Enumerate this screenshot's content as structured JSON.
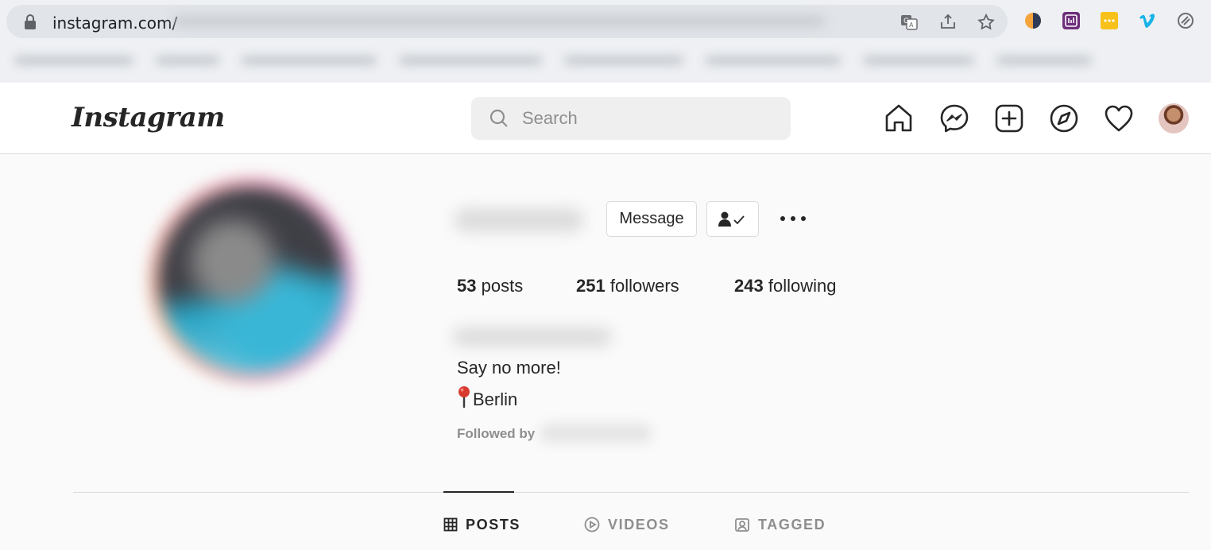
{
  "browser": {
    "url": "instagram.com/",
    "icons": [
      "lock-icon",
      "translate-icon",
      "share-icon",
      "bookmark-star-icon"
    ],
    "extensions": [
      "extension-color-wheel-icon",
      "extension-purple-app-icon",
      "extension-yellow-dots-icon",
      "extension-vimeo-icon",
      "extension-circle-slash-icon"
    ]
  },
  "header": {
    "logo": "Instagram",
    "search_placeholder": "Search",
    "nav_icons": [
      "home-icon",
      "messenger-icon",
      "new-post-icon",
      "explore-icon",
      "activity-heart-icon",
      "profile-avatar"
    ]
  },
  "profile": {
    "message_button": "Message",
    "stats": {
      "posts_count": "53",
      "posts_label": "posts",
      "followers_count": "251",
      "followers_label": "followers",
      "following_count": "243",
      "following_label": "following"
    },
    "bio": {
      "line1": "Say no more!",
      "location": "Berlin"
    },
    "followed_by": "Followed by"
  },
  "tabs": [
    {
      "label": "POSTS",
      "active": true,
      "icon": "grid-icon"
    },
    {
      "label": "VIDEOS",
      "active": false,
      "icon": "play-circle-icon"
    },
    {
      "label": "TAGGED",
      "active": false,
      "icon": "tagged-icon"
    }
  ],
  "colors": {
    "text": "#262626",
    "muted": "#8e8e8e",
    "border": "#dbdbdb",
    "page_bg": "#fafafa"
  }
}
